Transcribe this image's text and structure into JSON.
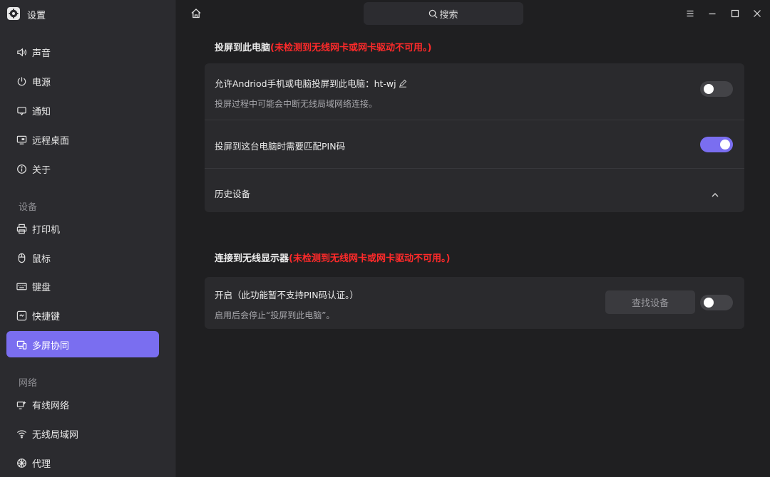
{
  "app": {
    "title": "设置"
  },
  "search": {
    "placeholder": "搜索"
  },
  "sidebar": {
    "items": [
      {
        "label": "声音",
        "icon": "speaker-icon"
      },
      {
        "label": "电源",
        "icon": "power-icon"
      },
      {
        "label": "通知",
        "icon": "notification-icon"
      },
      {
        "label": "远程桌面",
        "icon": "remote-desktop-icon"
      },
      {
        "label": "关于",
        "icon": "info-icon"
      }
    ],
    "sections": [
      {
        "label": "设备",
        "items": [
          {
            "label": "打印机",
            "icon": "printer-icon"
          },
          {
            "label": "鼠标",
            "icon": "mouse-icon"
          },
          {
            "label": "键盘",
            "icon": "keyboard-icon"
          },
          {
            "label": "快捷键",
            "icon": "shortcut-icon"
          },
          {
            "label": "多屏协同",
            "icon": "multiscreen-icon",
            "active": true
          }
        ]
      },
      {
        "label": "网络",
        "items": [
          {
            "label": "有线网络",
            "icon": "wired-network-icon"
          },
          {
            "label": "无线局域网",
            "icon": "wifi-icon"
          },
          {
            "label": "代理",
            "icon": "proxy-icon"
          }
        ]
      }
    ]
  },
  "cast_to_pc": {
    "title": "投屏到此电脑",
    "warning": "(未检测到无线网卡或网卡驱动不可用。)",
    "allow": {
      "title": "允许Andriod手机或电脑投屏到此电脑：ht-wj",
      "subtitle": "投屏过程中可能会中断无线局域网络连接。",
      "enabled": false
    },
    "pin": {
      "title": "投屏到这台电脑时需要匹配PIN码",
      "enabled": true
    },
    "history": {
      "title": "历史设备",
      "expanded": true
    }
  },
  "wireless_display": {
    "title": "连接到无线显示器",
    "warning": "(未检测到无线网卡或网卡驱动不可用。)",
    "enable": {
      "title": "开启（此功能暂不支持PIN码认证。）",
      "subtitle": "启用后会停止“投屏到此电脑”。",
      "find_button": "查找设备",
      "enabled": false
    }
  },
  "colors": {
    "accent": "#7a6ef0",
    "warning": "#ff2a2a",
    "sidebar_bg": "#2b2b2f",
    "content_bg": "#1f1f21",
    "card_bg": "#2a2a2d"
  }
}
